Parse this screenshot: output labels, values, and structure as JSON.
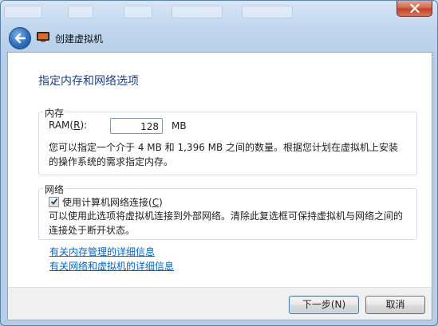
{
  "nav": {
    "title": "创建虚拟机"
  },
  "heading": "指定内存和网络选项",
  "memory_group": {
    "title": "内存",
    "ram_label_prefix": "RAM(",
    "ram_label_key": "R",
    "ram_label_suffix": "):",
    "ram_value": "128",
    "ram_unit": "MB",
    "description_line1": "您可以指定一个介于 4 MB 和 1,396 MB 之间的数量。根据您计划在虚拟机上安装",
    "description_line2": "的操作系统的需求指定内存。"
  },
  "network_group": {
    "title": "网络",
    "checkbox_prefix": "使用计算机网络连接(",
    "checkbox_key": "C",
    "checkbox_suffix": ")",
    "checked": true,
    "description_line1": "可以使用此选项将虚拟机连接到外部网络。清除此复选框可保持虚拟机与网络之间的",
    "description_line2": "连接处于断开状态。"
  },
  "links": {
    "memory_info": "有关内存管理的详细信息",
    "network_info": "有关网络和虚拟机的详细信息"
  },
  "buttons": {
    "next": "下一步(N)",
    "cancel": "取消"
  },
  "icons": {
    "back": "back-arrow-icon",
    "app": "virtual-pc-icon",
    "close": "close-icon",
    "check": "checkmark-icon"
  },
  "colors": {
    "heading": "#1e3f8c",
    "link": "#0066cc",
    "close": "#c0422a"
  }
}
